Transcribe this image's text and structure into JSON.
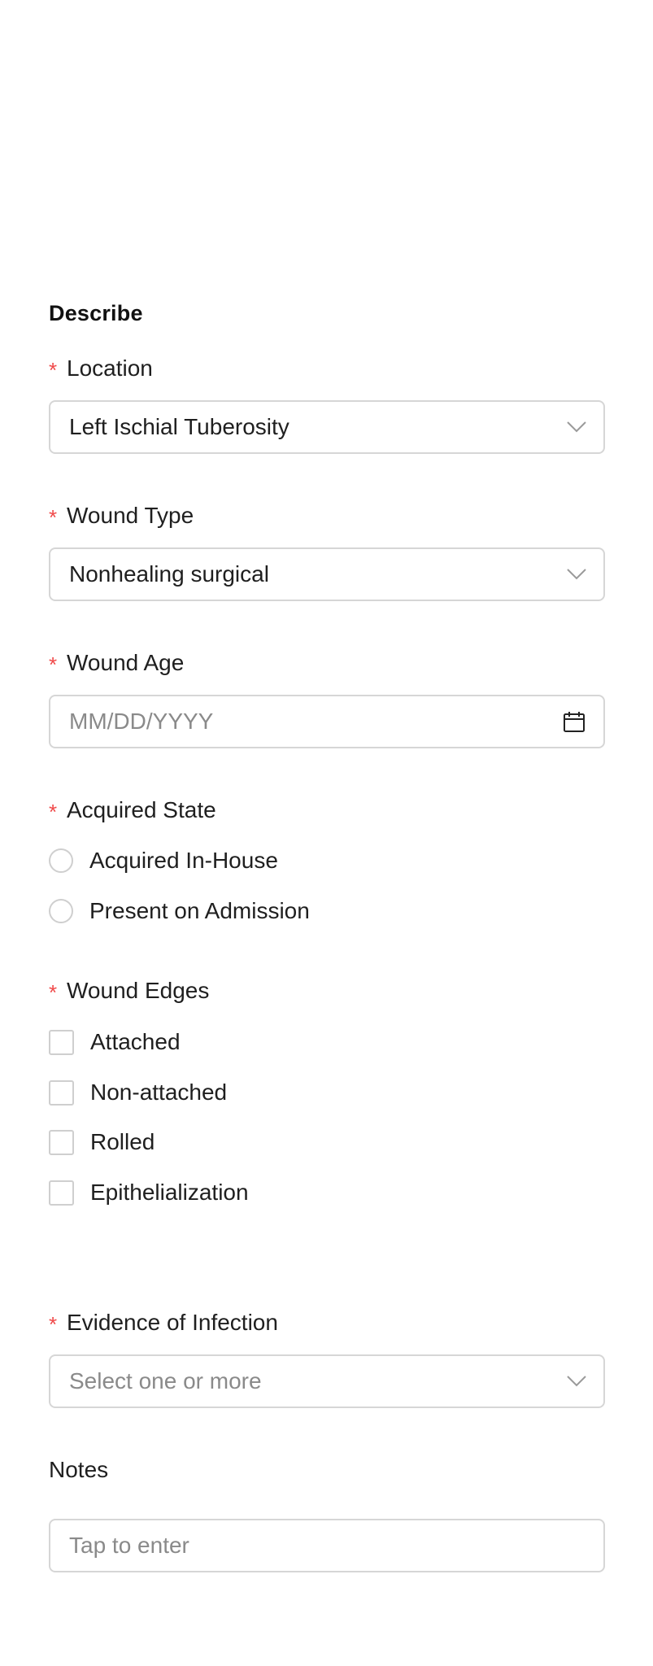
{
  "section_title": "Describe",
  "required_marker": "*",
  "colors": {
    "required": "#f04a4a",
    "border": "#d6d6d6",
    "placeholder": "#8a8a8a"
  },
  "location": {
    "label": "Location",
    "value": "Left Ischial Tuberosity",
    "icon": "chevron-down-icon"
  },
  "wound_type": {
    "label": "Wound Type",
    "value": "Nonhealing surgical",
    "icon": "chevron-down-icon"
  },
  "wound_age": {
    "label": "Wound Age",
    "placeholder": "MM/DD/YYYY",
    "icon": "calendar-icon"
  },
  "acquired_state": {
    "label": "Acquired State",
    "options": [
      "Acquired In-House",
      "Present on Admission"
    ]
  },
  "wound_edges": {
    "label": "Wound Edges",
    "options": [
      "Attached",
      "Non-attached",
      "Rolled",
      "Epithelialization"
    ]
  },
  "evidence_of_infection": {
    "label": "Evidence of Infection",
    "placeholder": "Select one or more",
    "icon": "chevron-down-icon"
  },
  "notes": {
    "label": "Notes",
    "placeholder": "Tap to enter"
  }
}
